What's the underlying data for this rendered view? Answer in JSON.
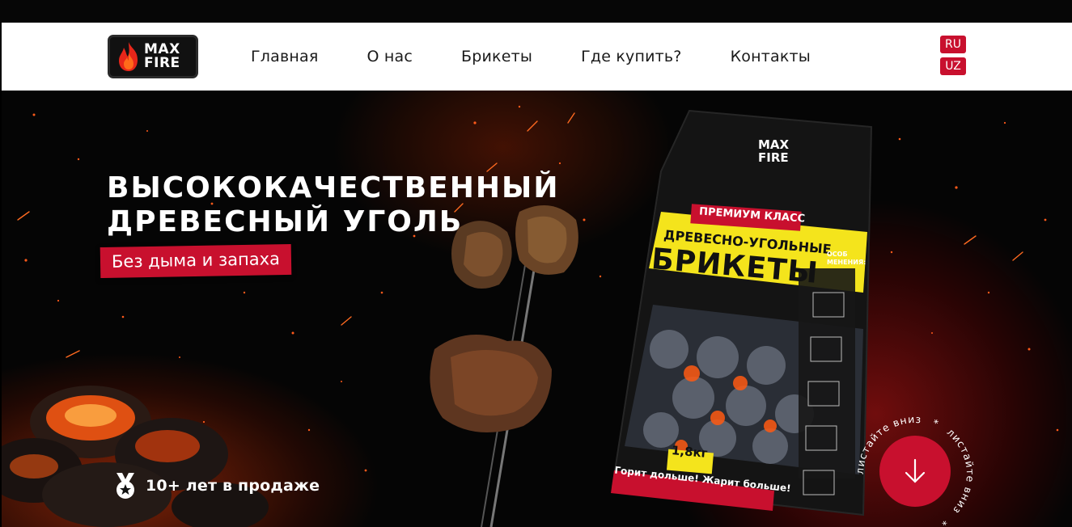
{
  "brand": {
    "logo_line1": "MAX",
    "logo_line2": "FIRE"
  },
  "nav": {
    "items": [
      {
        "label": "Главная"
      },
      {
        "label": "О нас"
      },
      {
        "label": "Брикеты"
      },
      {
        "label": "Где купить?"
      },
      {
        "label": "Контакты"
      }
    ]
  },
  "languages": [
    "RU",
    "UZ"
  ],
  "hero": {
    "headline_line1": "ВЫСОКОКАЧЕСТВЕННЫЙ",
    "headline_line2": "ДРЕВЕСНЫЙ УГОЛЬ",
    "tagline": "Без дыма и запаха",
    "badge_text": "10+ лет в продаже",
    "scroll_label": "листайте вниз",
    "scroll_separator": "*"
  },
  "package": {
    "logo_line1": "MAX",
    "logo_line2": "FIRE",
    "ribbon": "ПРЕМИУМ КЛАСС",
    "subtitle": "ДРЕВЕСНО-УГОЛЬНЫЕ",
    "title": "БРИКЕТЫ",
    "side_label_1": "ОСОБ",
    "side_label_2": "МЕНЕНИЯ:",
    "weight": "1,8кг",
    "slogan": "Горит дольше! Жарит больше!"
  },
  "colors": {
    "accent_red": "#c8102e",
    "package_yellow": "#f4e41c",
    "nav_text": "#1a1a1a",
    "background": "#050505"
  },
  "icons": {
    "logo": "flame-icon",
    "badge": "medal-icon",
    "scroll": "arrow-down-icon"
  }
}
